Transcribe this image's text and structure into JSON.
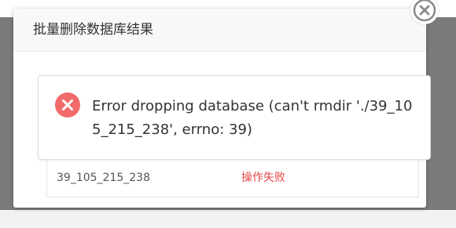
{
  "dialog": {
    "title": "批量删除数据库结果",
    "close_icon": "close-icon"
  },
  "alert": {
    "icon": "error-icon",
    "message": "Error dropping database (can't rmdir './39_105_215_238', errno: 39)",
    "color": "#f26b6b"
  },
  "results": {
    "rows": [
      {
        "database": "39_105_215_238",
        "status": "操作失败",
        "status_color": "#e64545"
      }
    ]
  }
}
